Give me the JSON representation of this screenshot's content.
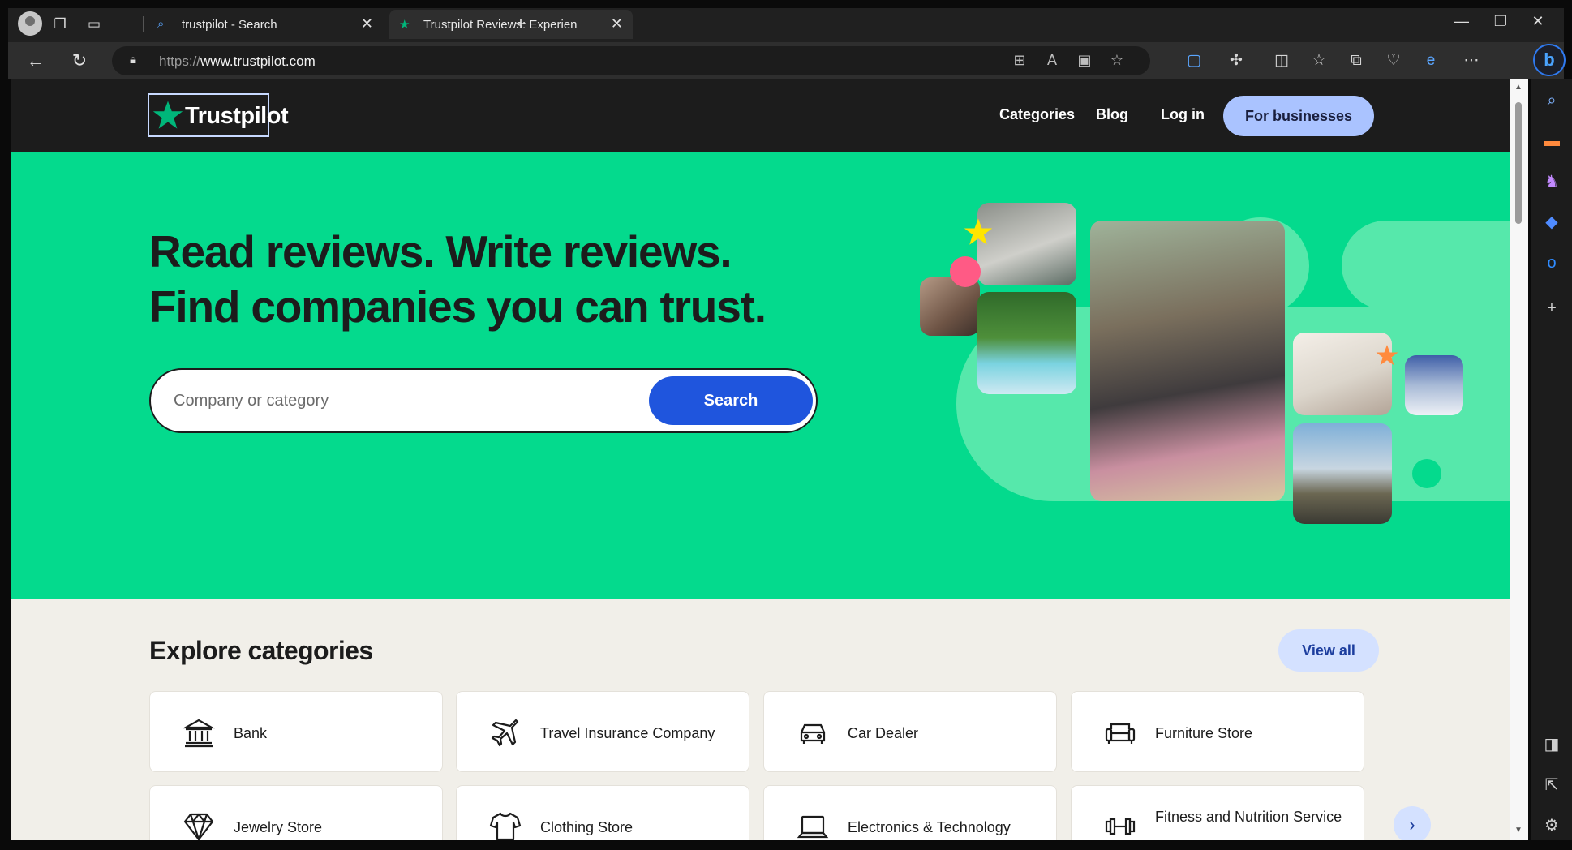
{
  "browser": {
    "tabs": [
      {
        "title": "trustpilot - Search",
        "icon": "search-icon"
      },
      {
        "title": "Trustpilot Reviews: Experience th",
        "icon": "trustpilot-star-icon"
      }
    ],
    "new_tab": "+",
    "url_scheme": "https://",
    "url_host": "www.trustpilot.com",
    "accent": "#2f7af0"
  },
  "site": {
    "logo_text": "Trustpilot",
    "nav": {
      "categories": "Categories",
      "blog": "Blog",
      "login": "Log in",
      "business": "For businesses"
    },
    "hero": {
      "line1": "Read reviews. Write reviews.",
      "line2": "Find companies you can trust.",
      "search_placeholder": "Company or category",
      "search_button": "Search",
      "bg_color": "#04da8d"
    },
    "categories": {
      "title": "Explore categories",
      "view_all": "View all",
      "items": [
        {
          "label": "Bank",
          "icon": "bank-icon"
        },
        {
          "label": "Travel Insurance Company",
          "icon": "plane-icon"
        },
        {
          "label": "Car Dealer",
          "icon": "car-icon"
        },
        {
          "label": "Furniture Store",
          "icon": "sofa-icon"
        },
        {
          "label": "Jewelry Store",
          "icon": "diamond-icon"
        },
        {
          "label": "Clothing Store",
          "icon": "tshirt-icon"
        },
        {
          "label": "Electronics & Technology",
          "icon": "laptop-icon"
        },
        {
          "label": "Fitness and Nutrition Service",
          "icon": "dumbbell-icon"
        }
      ]
    }
  }
}
